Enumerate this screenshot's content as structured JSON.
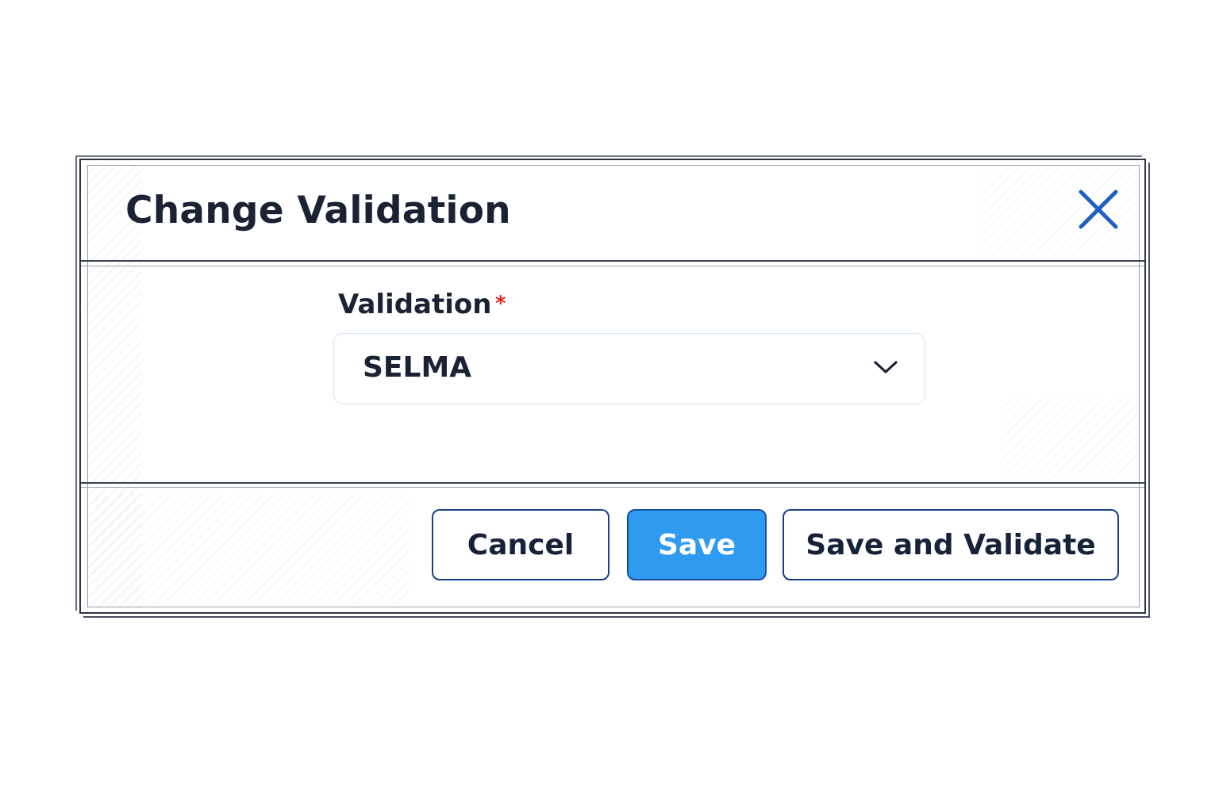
{
  "dialog": {
    "title": "Change Validation",
    "close_icon": "close-icon"
  },
  "form": {
    "validation_label": "Validation",
    "required_mark": "*",
    "validation_value": "SELMA",
    "dropdown_icon": "chevron-down-icon"
  },
  "footer": {
    "cancel_label": "Cancel",
    "save_label": "Save",
    "save_validate_label": "Save and Validate"
  },
  "colors": {
    "primary": "#2f9bf0",
    "primary_border": "#1a4fa0",
    "outline_border": "#1a3f8c",
    "text": "#1b2233",
    "required": "#e02424",
    "close_icon": "#1f5fbf"
  }
}
